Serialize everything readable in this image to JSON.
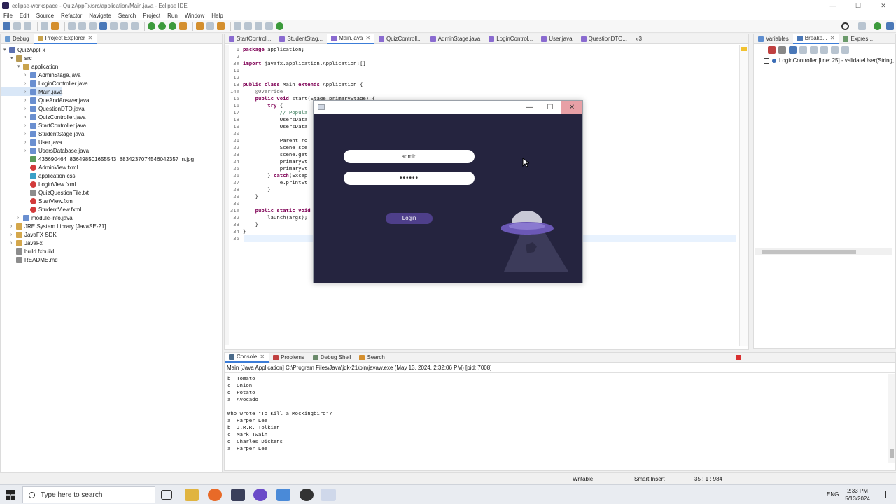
{
  "window": {
    "title": "eclipse-workspace - QuizAppFx/src/application/Main.java - Eclipse IDE",
    "minimize": "—",
    "maximize": "☐",
    "close": "✕"
  },
  "menu": [
    "File",
    "Edit",
    "Source",
    "Refactor",
    "Navigate",
    "Search",
    "Project",
    "Run",
    "Window",
    "Help"
  ],
  "left_tabs": {
    "debug": "Debug",
    "explorer": "Project Explorer"
  },
  "tree": [
    {
      "label": "QuizAppFx",
      "indent": 0,
      "icon": "proj",
      "tw": "▾"
    },
    {
      "label": "src",
      "indent": 1,
      "icon": "src",
      "tw": "▾"
    },
    {
      "label": "application",
      "indent": 2,
      "icon": "pkg",
      "tw": "▾"
    },
    {
      "label": "AdminStage.java",
      "indent": 3,
      "icon": "java",
      "tw": "›"
    },
    {
      "label": "LoginController.java",
      "indent": 3,
      "icon": "java",
      "tw": "›"
    },
    {
      "label": "Main.java",
      "indent": 3,
      "icon": "java",
      "tw": "›",
      "selected": true
    },
    {
      "label": "QueAndAnswer.java",
      "indent": 3,
      "icon": "java",
      "tw": "›"
    },
    {
      "label": "QuestionDTO.java",
      "indent": 3,
      "icon": "java",
      "tw": "›"
    },
    {
      "label": "QuizController.java",
      "indent": 3,
      "icon": "java",
      "tw": "›"
    },
    {
      "label": "StartController.java",
      "indent": 3,
      "icon": "java",
      "tw": "›"
    },
    {
      "label": "StudentStage.java",
      "indent": 3,
      "icon": "java",
      "tw": "›"
    },
    {
      "label": "User.java",
      "indent": 3,
      "icon": "java",
      "tw": "›"
    },
    {
      "label": "UsersDatabase.java",
      "indent": 3,
      "icon": "java",
      "tw": "›"
    },
    {
      "label": "436690464_836498501655543_8834237074546042357_n.jpg",
      "indent": 3,
      "icon": "jpg",
      "tw": ""
    },
    {
      "label": "AdminView.fxml",
      "indent": 3,
      "icon": "fxml",
      "tw": ""
    },
    {
      "label": "application.css",
      "indent": 3,
      "icon": "css",
      "tw": ""
    },
    {
      "label": "LoginView.fxml",
      "indent": 3,
      "icon": "fxml",
      "tw": ""
    },
    {
      "label": "QuizQuestionFile.txt",
      "indent": 3,
      "icon": "txt",
      "tw": ""
    },
    {
      "label": "StartView.fxml",
      "indent": 3,
      "icon": "fxml",
      "tw": ""
    },
    {
      "label": "StudentView.fxml",
      "indent": 3,
      "icon": "fxml",
      "tw": ""
    },
    {
      "label": "module-info.java",
      "indent": 2,
      "icon": "java",
      "tw": "›"
    },
    {
      "label": "JRE System Library [JavaSE-21]",
      "indent": 1,
      "icon": "lib",
      "tw": "›"
    },
    {
      "label": "JavaFX SDK",
      "indent": 1,
      "icon": "lib",
      "tw": "›"
    },
    {
      "label": "JavaFx",
      "indent": 1,
      "icon": "lib",
      "tw": "›"
    },
    {
      "label": "build.fxbuild",
      "indent": 1,
      "icon": "txt",
      "tw": ""
    },
    {
      "label": "README.md",
      "indent": 1,
      "icon": "txt",
      "tw": ""
    }
  ],
  "editor_tabs": [
    {
      "label": "StartControl...",
      "active": false
    },
    {
      "label": "StudentStag...",
      "active": false
    },
    {
      "label": "Main.java",
      "active": true
    },
    {
      "label": "QuizControll...",
      "active": false
    },
    {
      "label": "AdminStage.java",
      "active": false
    },
    {
      "label": "LoginControl...",
      "active": false
    },
    {
      "label": "User.java",
      "active": false
    },
    {
      "label": "QuestionDTO...",
      "active": false
    }
  ],
  "editor_overflow": "»3",
  "code": [
    {
      "n": "1",
      "t": "package application;"
    },
    {
      "n": "2",
      "t": ""
    },
    {
      "n": "3⊕",
      "t": "import javafx.application.Application;[]"
    },
    {
      "n": "11",
      "t": ""
    },
    {
      "n": "12",
      "t": ""
    },
    {
      "n": "13",
      "t": "public class Main extends Application {"
    },
    {
      "n": "14⊖",
      "t": "    @Override"
    },
    {
      "n": "15",
      "t": "    public void start(Stage primaryStage) {"
    },
    {
      "n": "16",
      "t": "        try {"
    },
    {
      "n": "17",
      "t": "            // Popula"
    },
    {
      "n": "18",
      "t": "            UsersData"
    },
    {
      "n": "19",
      "t": "            UsersData"
    },
    {
      "n": "20",
      "t": ""
    },
    {
      "n": "21",
      "t": "            Parent ro"
    },
    {
      "n": "22",
      "t": "            Scene sce"
    },
    {
      "n": "23",
      "t": "            scene.get"
    },
    {
      "n": "24",
      "t": "            primarySt"
    },
    {
      "n": "25",
      "t": "            primarySt"
    },
    {
      "n": "26",
      "t": "        } catch(Excep"
    },
    {
      "n": "27",
      "t": "            e.printSt"
    },
    {
      "n": "28",
      "t": "        }"
    },
    {
      "n": "29",
      "t": "    }"
    },
    {
      "n": "30",
      "t": ""
    },
    {
      "n": "31⊖",
      "t": "    public static void"
    },
    {
      "n": "32",
      "t": "        launch(args);"
    },
    {
      "n": "33",
      "t": "    }"
    },
    {
      "n": "34",
      "t": "}"
    },
    {
      "n": "35",
      "t": ""
    }
  ],
  "right_tabs": {
    "variables": "Variables",
    "breakpoints": "Breakp...",
    "expressions": "Expres..."
  },
  "breakpoint": "LoginController [line: 25] - validateUser(String,",
  "console_tabs": {
    "console": "Console",
    "problems": "Problems",
    "debug_shell": "Debug Shell",
    "search": "Search"
  },
  "console_header": "Main [Java Application] C:\\Program Files\\Java\\jdk-21\\bin\\javaw.exe  (May 13, 2024, 2:32:06 PM) [pid: 7008]",
  "console_lines": [
    "b. Tomato",
    "c. Onion",
    "d. Potato",
    "a. Avocado",
    "",
    "Who wrote \"To Kill a Mockingbird\"?",
    "a. Harper Lee",
    "b. J.R.R. Tolkien",
    "c. Mark Twain",
    "d. Charles Dickens",
    "a. Harper Lee"
  ],
  "status": {
    "writable": "Writable",
    "insert": "Smart Insert",
    "position": "35 : 1 : 984"
  },
  "fx": {
    "username": "admin",
    "password": "••••••",
    "login_label": "Login",
    "accent": "#4e3f8a",
    "bg": "#25243f"
  },
  "taskbar": {
    "search_placeholder": "Type here to search",
    "lang": "ENG",
    "time": "2:33 PM",
    "date": "5/13/2024"
  }
}
